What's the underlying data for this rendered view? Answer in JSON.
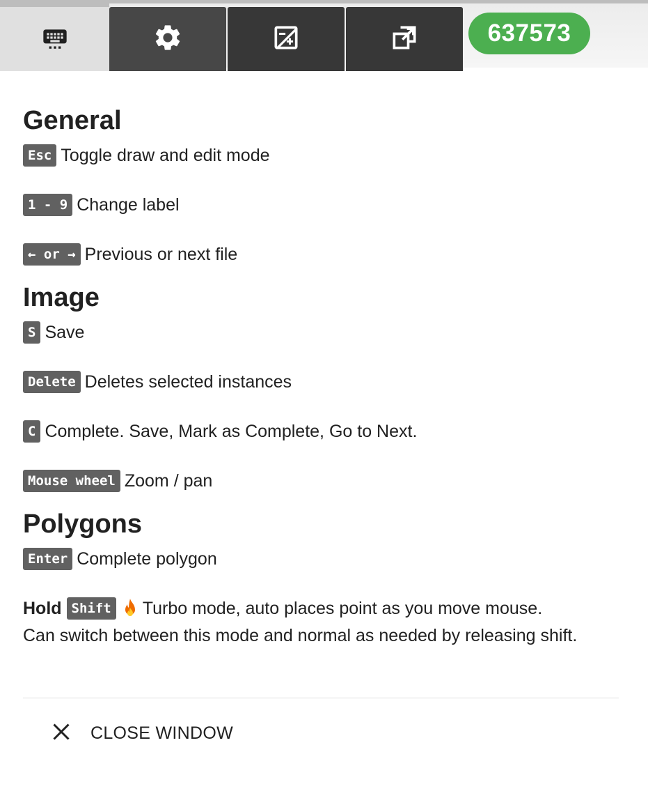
{
  "toolbar": {
    "tabs": [
      {
        "icon": "keyboard-icon"
      },
      {
        "icon": "gear-icon"
      },
      {
        "icon": "exposure-plus-icon"
      },
      {
        "icon": "open-in-new-icon"
      }
    ],
    "count_badge": "637573",
    "badge_color": "#4caf50"
  },
  "sections": {
    "general": {
      "title": "General",
      "items": [
        {
          "key": "Esc",
          "text": "Toggle draw and edit mode"
        },
        {
          "key": "1 - 9",
          "text": "Change label"
        },
        {
          "key": "← or →",
          "text": "Previous or next file"
        }
      ]
    },
    "image": {
      "title": "Image",
      "items": [
        {
          "key": "S",
          "text": "Save"
        },
        {
          "key": "Delete",
          "text": "Deletes selected instances"
        },
        {
          "key": "C",
          "text": "Complete. Save, Mark as Complete, Go to Next."
        },
        {
          "key": "Mouse wheel",
          "text": "Zoom / pan"
        }
      ]
    },
    "polygons": {
      "title": "Polygons",
      "items": [
        {
          "key": "Enter",
          "text": "Complete polygon"
        }
      ],
      "turbo": {
        "prefix": "Hold",
        "key": "Shift",
        "icon": "fire-icon",
        "text": "Turbo mode, auto places point as you move mouse.",
        "text2": "Can switch between this mode and normal as needed by releasing shift."
      }
    }
  },
  "footer": {
    "close_label": "CLOSE WINDOW",
    "close_icon": "close-icon"
  }
}
